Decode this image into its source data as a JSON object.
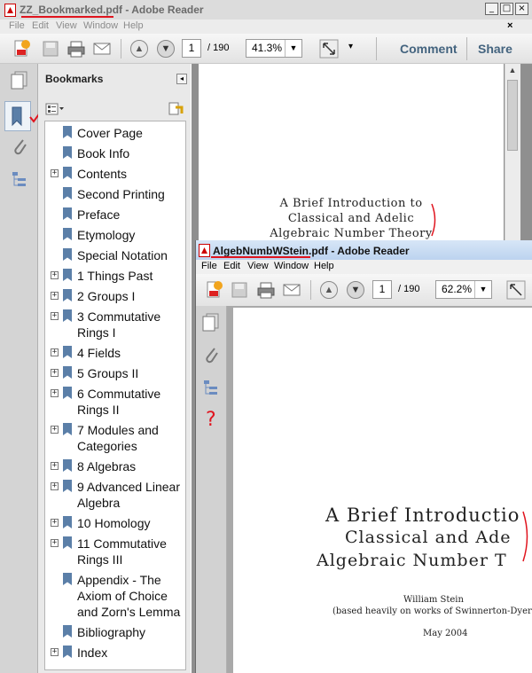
{
  "window1": {
    "title": "ZZ_Bookmarked.pdf - Adobe Reader",
    "menu": [
      "File",
      "Edit",
      "View",
      "Window",
      "Help"
    ],
    "page_current": "1",
    "page_total": "/ 190",
    "zoom": "41.3%",
    "comment_label": "Comment",
    "share_label": "Share",
    "bookmarks_title": "Bookmarks",
    "bookmarks": [
      {
        "label": "Cover Page",
        "expandable": false
      },
      {
        "label": "Book Info",
        "expandable": false
      },
      {
        "label": "Contents",
        "expandable": true
      },
      {
        "label": "Second Printing",
        "expandable": false
      },
      {
        "label": "Preface",
        "expandable": false
      },
      {
        "label": "Etymology",
        "expandable": false
      },
      {
        "label": "Special Notation",
        "expandable": false
      },
      {
        "label": "1 Things Past",
        "expandable": true
      },
      {
        "label": "2 Groups I",
        "expandable": true
      },
      {
        "label": "3 Commutative\nRings I",
        "expandable": true
      },
      {
        "label": "4 Fields",
        "expandable": true
      },
      {
        "label": "5 Groups II",
        "expandable": true
      },
      {
        "label": "6 Commutative\nRings II",
        "expandable": true
      },
      {
        "label": "7 Modules and\nCategories",
        "expandable": true
      },
      {
        "label": "8 Algebras",
        "expandable": true
      },
      {
        "label": "9 Advanced Linear\nAlgebra",
        "expandable": true
      },
      {
        "label": "10 Homology",
        "expandable": true
      },
      {
        "label": "11 Commutative\nRings III",
        "expandable": true
      },
      {
        "label": "Appendix - The\nAxiom of Choice\nand Zorn's Lemma",
        "expandable": false
      },
      {
        "label": "Bibliography",
        "expandable": false
      },
      {
        "label": "Index",
        "expandable": true
      }
    ],
    "page_title_lines": [
      "A Brief Introduction to",
      "Classical and Adelic",
      "Algebraic Number Theory"
    ]
  },
  "window2": {
    "title": "AlgebNumbWStein.pdf - Adobe Reader",
    "menu": [
      "File",
      "Edit",
      "View",
      "Window",
      "Help"
    ],
    "page_current": "1",
    "page_total": "/ 190",
    "zoom": "62.2%",
    "page_title_lines": [
      "A Brief Introductio",
      "Classical and Ade",
      "Algebraic Number T"
    ],
    "author": "William Stein",
    "based_on": "(based heavily on works of Swinnerton-Dyer and",
    "date": "May 2004",
    "question_mark": "?"
  },
  "colors": {
    "annotation_red": "#e0141e",
    "link_blue": "#44647f"
  }
}
